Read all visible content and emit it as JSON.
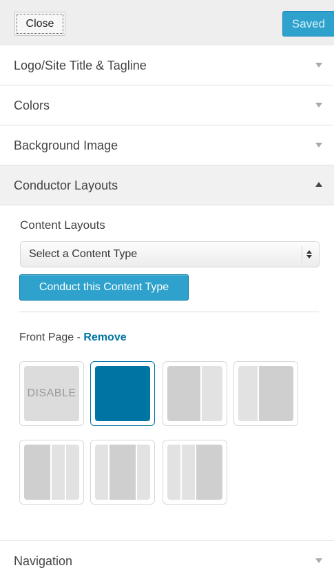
{
  "header": {
    "close_label": "Close",
    "saved_label": "Saved"
  },
  "sections": [
    {
      "title": "Logo/Site Title & Tagline",
      "expanded": false
    },
    {
      "title": "Colors",
      "expanded": false
    },
    {
      "title": "Background Image",
      "expanded": false
    },
    {
      "title": "Conductor Layouts",
      "expanded": true
    }
  ],
  "conductor": {
    "content_layouts_label": "Content Layouts",
    "select_value": "Select a Content Type",
    "conduct_button_label": "Conduct this Content Type",
    "front_page_label": "Front Page - ",
    "remove_label": "Remove",
    "layouts": [
      {
        "id": "disable",
        "label": "DISABLE",
        "selected": false
      },
      {
        "id": "full-width",
        "selected": true
      },
      {
        "id": "content-sidebar",
        "selected": false
      },
      {
        "id": "sidebar-content",
        "selected": false
      },
      {
        "id": "content-sidebar-sidebar",
        "selected": false
      },
      {
        "id": "sidebar-content-sidebar",
        "selected": false
      },
      {
        "id": "sidebar-sidebar-content",
        "selected": false
      }
    ]
  },
  "footer_section": {
    "title": "Navigation",
    "expanded": false
  },
  "colors": {
    "accent": "#2ea2cc",
    "accent_dark": "#0074a2",
    "panel_bg": "#eeeeee"
  }
}
